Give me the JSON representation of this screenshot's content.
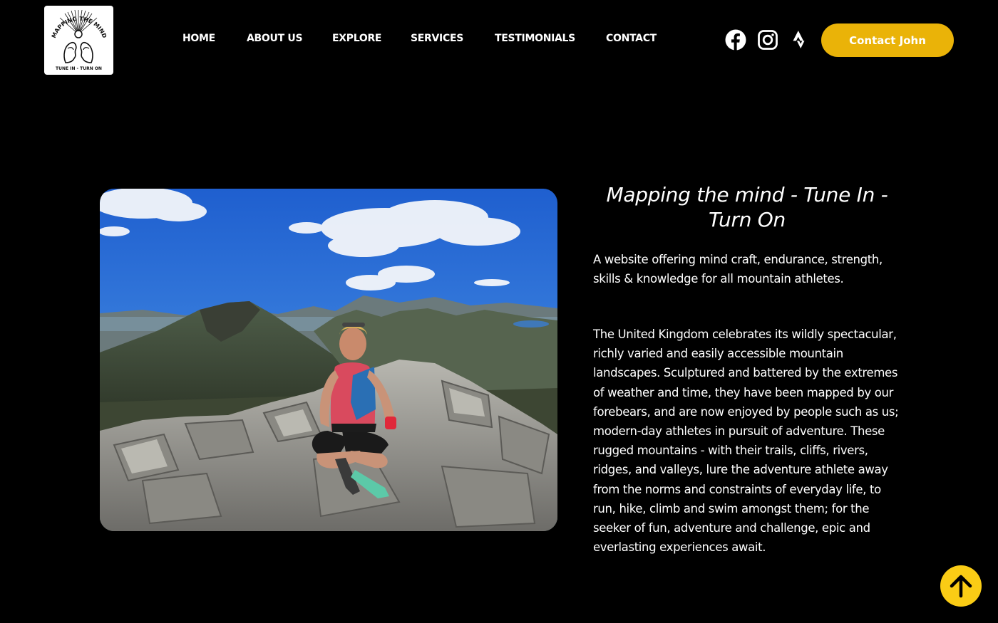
{
  "logo": {
    "arc_text": "MAPPING THE MIND",
    "tagline": "TUNE IN - TURN ON",
    "icon": "mapping-the-mind-logo"
  },
  "nav": {
    "items": [
      {
        "label": "HOME"
      },
      {
        "label": "ABOUT US"
      },
      {
        "label": "EXPLORE"
      },
      {
        "label": "SERVICES"
      },
      {
        "label": "TESTIMONIALS"
      },
      {
        "label": "CONTACT"
      }
    ]
  },
  "social": [
    {
      "icon": "facebook-icon"
    },
    {
      "icon": "instagram-icon"
    },
    {
      "icon": "strava-icon"
    }
  ],
  "cta": {
    "label": "Contact John"
  },
  "hero": {
    "image_alt": "Man sitting cross-legged on a rocky mountain summit",
    "headline": "Mapping the mind - Tune In - Turn On",
    "paragraphs": [
      "A website offering mind craft, endurance, strength, skills & knowledge for all mountain athletes.",
      "The United Kingdom celebrates its wildly spectacular, richly varied and easily accessible mountain landscapes. Sculptured and battered by the extremes of weather and time, they have been mapped by our forebears, and are now enjoyed by people such as us; modern-day athletes in pursuit of adventure. These rugged mountains - with their trails, cliffs, rivers, ridges, and valleys, lure the adventure athlete away from the norms and constraints of everyday life, to run, hike, climb and swim amongst them; for the seeker of fun, adventure and challenge, epic and everlasting experiences await."
    ]
  },
  "scroll_top": {
    "icon": "arrow-up-icon"
  },
  "colors": {
    "background": "#000000",
    "accent": "#eab308",
    "scroll_button": "#facc15",
    "text": "#ffffff"
  }
}
